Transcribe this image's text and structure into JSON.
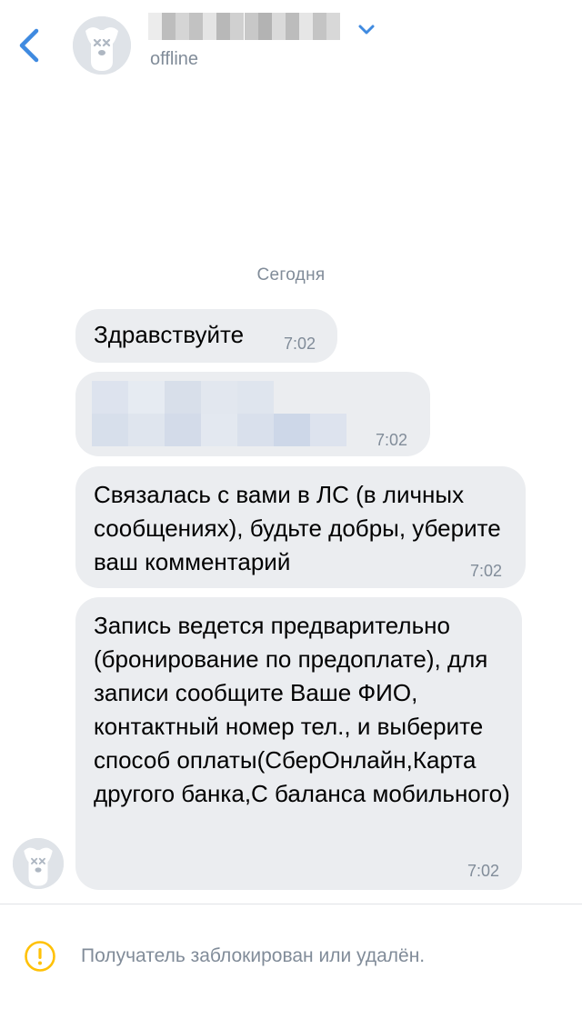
{
  "header": {
    "status": "offline",
    "back_icon": "chevron-left-icon",
    "menu_icon": "chevron-down-icon",
    "avatar_icon": "deactivated-dog-avatar"
  },
  "date_separator": "Сегодня",
  "messages": [
    {
      "text": "Здравствуйте",
      "time": "7:02"
    },
    {
      "text": "",
      "time": "7:02",
      "redacted": true
    },
    {
      "text": "Связалась с вами в ЛС (в личных сообщениях), будьте добры, уберите ваш комментарий",
      "time": "7:02"
    },
    {
      "text": "Запись ведется предварительно (бронирование по предоплате), для записи сообщите Ваше ФИО, контактный номер тел., и выберите способ оплаты(СберОнлайн,Карта другого банка,С баланса мобильного)",
      "time": "7:02"
    }
  ],
  "footer": {
    "icon": "warning-circle-icon",
    "text": "Получатель заблокирован или удалён."
  },
  "colors": {
    "accent": "#3f8ae0",
    "bubble": "#ebedf0",
    "secondary_text": "#818c99",
    "warning": "#ffc107"
  }
}
